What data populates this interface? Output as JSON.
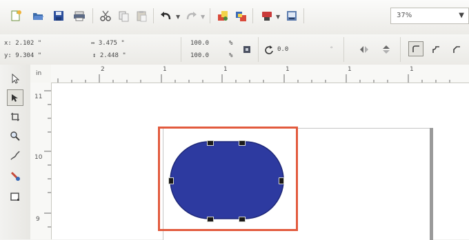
{
  "toolbar": {
    "buttons": [
      {
        "name": "new-document-icon"
      },
      {
        "name": "open-folder-icon"
      },
      {
        "name": "save-icon"
      },
      {
        "name": "print-icon"
      },
      {
        "name": "cut-icon"
      },
      {
        "name": "copy-icon"
      },
      {
        "name": "paste-icon"
      },
      {
        "name": "undo-icon"
      },
      {
        "name": "redo-icon"
      },
      {
        "name": "import-icon"
      },
      {
        "name": "export-icon"
      },
      {
        "name": "app-launcher-icon"
      },
      {
        "name": "welcome-screen-icon"
      }
    ],
    "zoom": "37%"
  },
  "property_bar": {
    "x": "x: 2.102 \"",
    "y": "y: 9.304 \"",
    "width": "3.475 \"",
    "height": "2.448 \"",
    "scale_x": "100.0",
    "scale_y": "100.0",
    "percent": "%",
    "rotation": "0.0"
  },
  "rulers": {
    "h_ticks": [
      "2",
      "1",
      "1",
      "1",
      "1",
      "1"
    ],
    "v_ticks": [
      "11",
      "10",
      "9"
    ],
    "corner_label": "in"
  },
  "colors": {
    "shape_fill": "#2d3aa0",
    "highlight": "#e25a3d",
    "handle": "#1a1a1a"
  }
}
